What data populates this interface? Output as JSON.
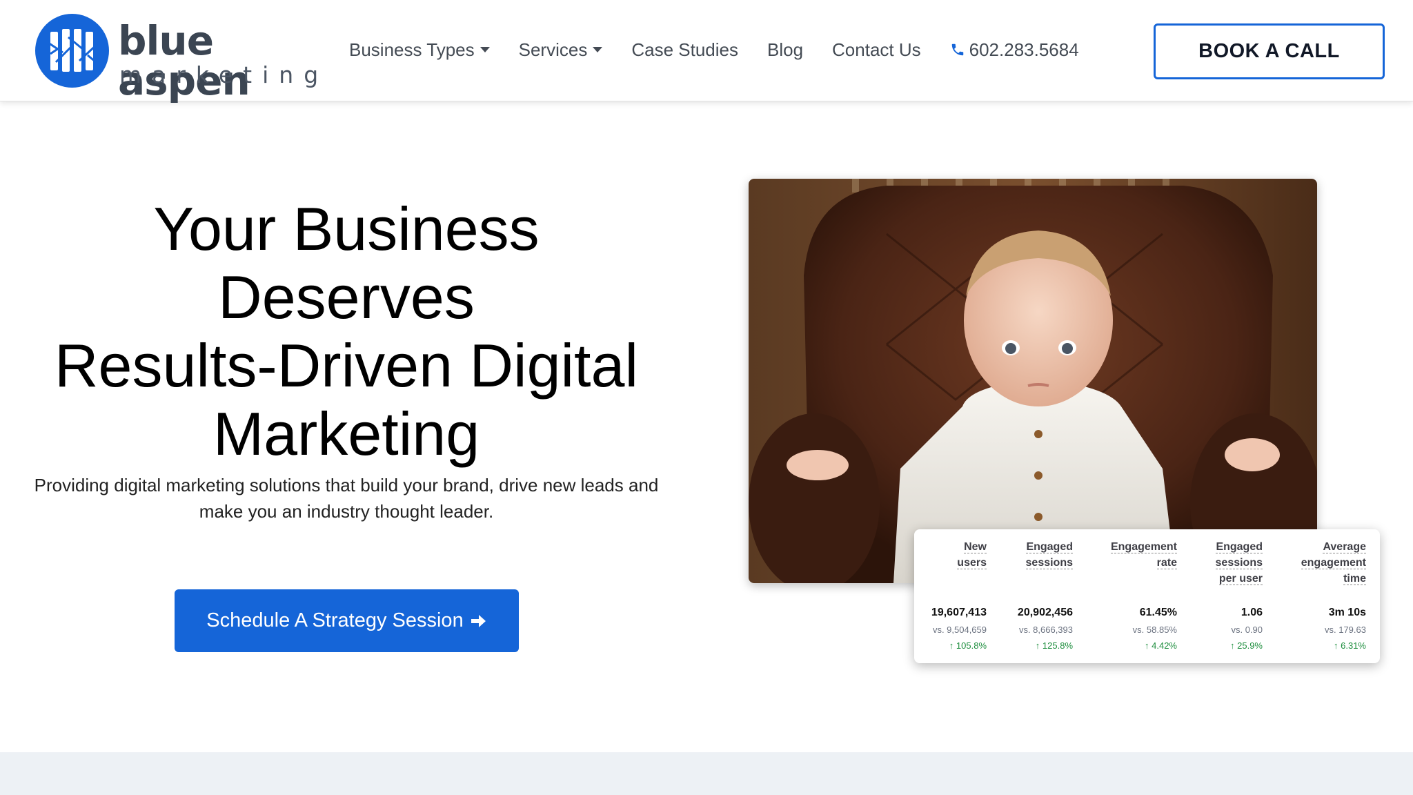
{
  "brand": {
    "name": "blue aspen",
    "sub": "marketing",
    "color": "#1565d8"
  },
  "nav": {
    "items": [
      {
        "label": "Business Types",
        "dropdown": true
      },
      {
        "label": "Services",
        "dropdown": true
      },
      {
        "label": "Case Studies",
        "dropdown": false
      },
      {
        "label": "Blog",
        "dropdown": false
      },
      {
        "label": "Contact Us",
        "dropdown": false
      }
    ],
    "phone": "602.283.5684",
    "phone_icon": "phone-icon"
  },
  "header": {
    "cta_label": "BOOK A CALL"
  },
  "hero": {
    "title_lines": [
      "Your Business",
      "Deserves",
      "Results-Driven Digital",
      "Marketing"
    ],
    "subtitle_lines": [
      "Providing digital marketing solutions that build your brand, drive new leads and",
      "make you an industry thought leader."
    ],
    "cta_label": "Schedule A Strategy Session",
    "cta_icon": "arrow-right-icon"
  },
  "stats": [
    {
      "head": [
        "New",
        "users"
      ],
      "value": "19,607,413",
      "prev": "vs. 9,504,659",
      "change": "105.8%"
    },
    {
      "head": [
        "Engaged",
        "sessions"
      ],
      "value": "20,902,456",
      "prev": "vs. 8,666,393",
      "change": "125.8%"
    },
    {
      "head": [
        "Engagement",
        "rate"
      ],
      "value": "61.45%",
      "prev": "vs. 58.85%",
      "change": "4.42%"
    },
    {
      "head": [
        "Engaged",
        "sessions",
        "per user"
      ],
      "value": "1.06",
      "prev": "vs. 0.90",
      "change": "25.9%"
    },
    {
      "head": [
        "Average",
        "engagement",
        "time"
      ],
      "value": "3m 10s",
      "prev": "vs. 179.63",
      "change": "6.31%"
    }
  ],
  "colors": {
    "change_up": "#1e8e3e",
    "footer_band": "#edf1f5"
  }
}
